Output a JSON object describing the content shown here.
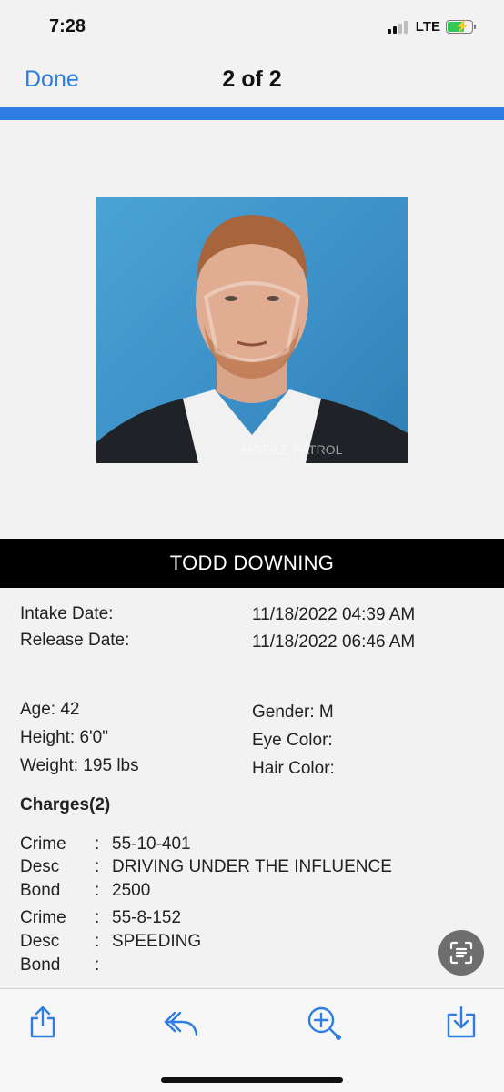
{
  "status_bar": {
    "time": "7:28",
    "network": "LTE"
  },
  "nav": {
    "done_label": "Done",
    "page_indicator": "2 of 2"
  },
  "photo": {
    "watermark": "MOBILE PATROL"
  },
  "record": {
    "name": "TODD DOWNING",
    "intake_label": "Intake Date:",
    "intake_value": "11/18/2022 04:39 AM",
    "release_label": "Release Date:",
    "release_value": "11/18/2022 06:46 AM",
    "age": "Age: 42",
    "height": "Height: 6'0\"",
    "weight": "Weight: 195 lbs",
    "gender": "Gender: M",
    "eye_color": "Eye Color:",
    "hair_color": "Hair Color:"
  },
  "charges": {
    "title": "Charges(2)",
    "colon": ":",
    "labels": {
      "crime": "Crime",
      "desc": "Desc",
      "bond": "Bond"
    },
    "items": [
      {
        "crime": "55-10-401",
        "desc": "DRIVING UNDER THE INFLUENCE",
        "bond": "2500"
      },
      {
        "crime": "55-8-152",
        "desc": "SPEEDING",
        "bond": ""
      }
    ]
  },
  "toolbar": {
    "icons": [
      "share-icon",
      "reply-icon",
      "zoom-in-icon",
      "download-icon"
    ]
  },
  "colors": {
    "accent": "#2d7de3",
    "name_bar": "#000000",
    "background": "#f2f2f2"
  }
}
